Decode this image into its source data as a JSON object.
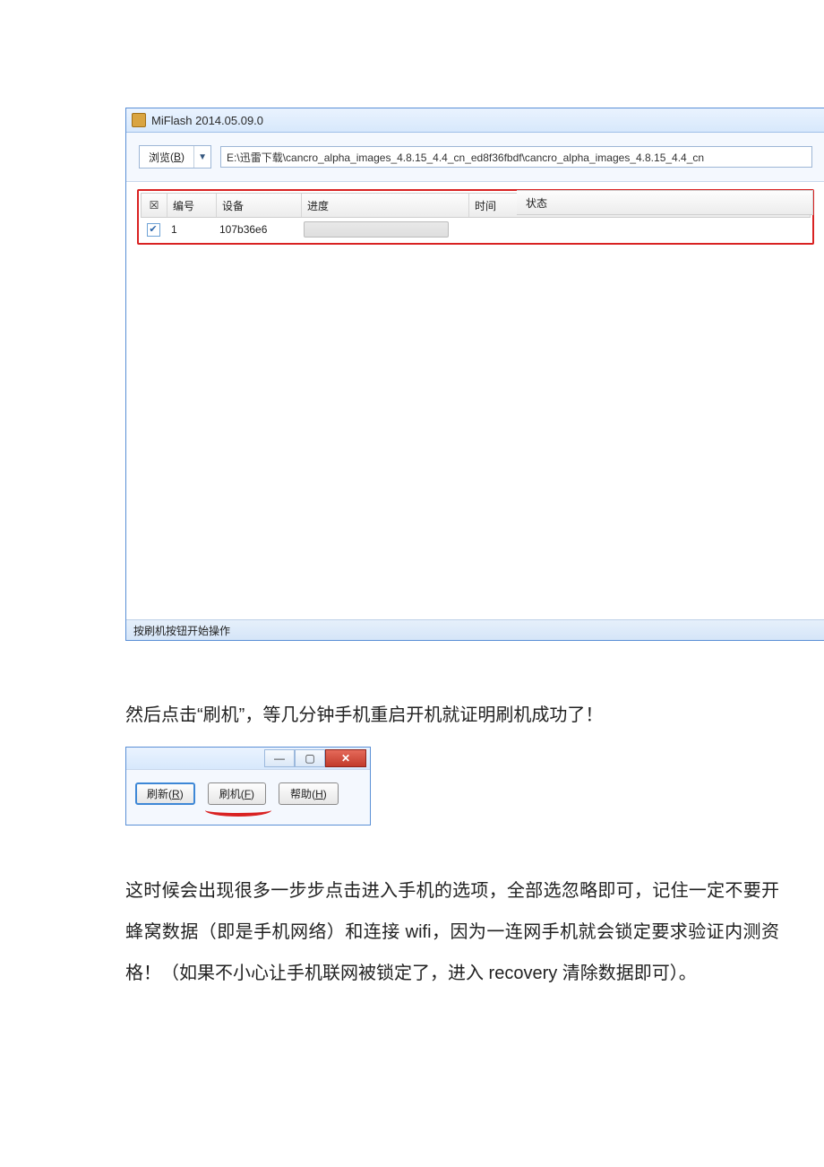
{
  "miflash": {
    "window_title": "MiFlash 2014.05.09.0",
    "browse_label": "浏览",
    "browse_hotkey": "B",
    "path_value": "E:\\迅雷下载\\cancro_alpha_images_4.8.15_4.4_cn_ed8f36fbdf\\cancro_alpha_images_4.8.15_4.4_cn",
    "columns": {
      "checkbox_header": "☒",
      "id": "编号",
      "device": "设备",
      "progress": "进度",
      "time": "时间",
      "status": "状态"
    },
    "row": {
      "checked_mark": "✔",
      "id": "1",
      "device": "107b36e6",
      "time": "",
      "status": ""
    },
    "statusbar_text": "按刷机按钮开始操作"
  },
  "paragraph1": "然后点击“刷机”，等几分钟手机重启开机就证明刷机成功了！",
  "smallcrop": {
    "close_glyph": "✕",
    "btn_refresh": "刷新",
    "btn_refresh_hk": "R",
    "btn_flash": "刷机",
    "btn_flash_hk": "F",
    "btn_help": "帮助",
    "btn_help_hk": "H"
  },
  "paragraph2": "这时候会出现很多一步步点击进入手机的选项，全部选忽略即可，记住一定不要开蜂窝数据（即是手机网络）和连接 wifi，因为一连网手机就会锁定要求验证内测资格！（如果不小心让手机联网被锁定了，进入 recovery 清除数据即可）。"
}
